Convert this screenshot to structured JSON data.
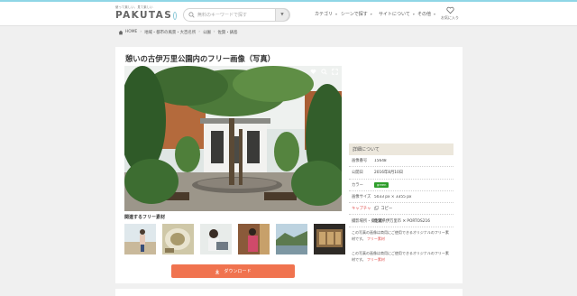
{
  "header": {
    "tagline": "使って楽しい、見て楽しい",
    "logo_text": "PAKUTAS",
    "search_placeholder": "無料のキーワードで探す",
    "nav": [
      "カテゴリ",
      "シーンで探す",
      "サイトについて",
      "その他"
    ],
    "favorite_label": "お気に入り"
  },
  "breadcrumb": [
    "HOME",
    "地域・都市の風景・大百名所",
    "公園",
    "佐賀・鍋島"
  ],
  "main": {
    "title": "憩いの古伊万里公園内のフリー画像（写真）",
    "related_title": "関連するフリー素材",
    "download_label": "ダウンロード"
  },
  "details": {
    "heading": "詳細について",
    "rows": [
      {
        "label": "画像番号",
        "value": "15648"
      },
      {
        "label": "公開日",
        "value": "2016年8月10日"
      },
      {
        "label": "カラー",
        "value": "green"
      },
      {
        "label": "画像サイズ",
        "value": "5033 px × 3355 px"
      },
      {
        "label": "キャプチャ",
        "value": "コピー"
      },
      {
        "label": "撮影場所・撮影者",
        "value": "佐賀県伊万里市 ✕ PORTOS216"
      }
    ],
    "note_1": "この写真の画像は商用にご使用できるオリジナルのフリー素材です。",
    "note_2": "この写真の画像は商用にご使用できるオリジナルのフリー素材です。",
    "note_link": "フリー素材"
  },
  "icons": [
    "search-icon",
    "chevron-down-icon",
    "heart-icon",
    "home-icon",
    "heart-icon",
    "zoom-icon",
    "expand-icon",
    "download-icon",
    "copy-icon"
  ],
  "colors": {
    "accent": "#f0734f",
    "link": "#e0504e",
    "color_chip": "#2e9e2b",
    "header_stripe": "#8fd6e6"
  }
}
